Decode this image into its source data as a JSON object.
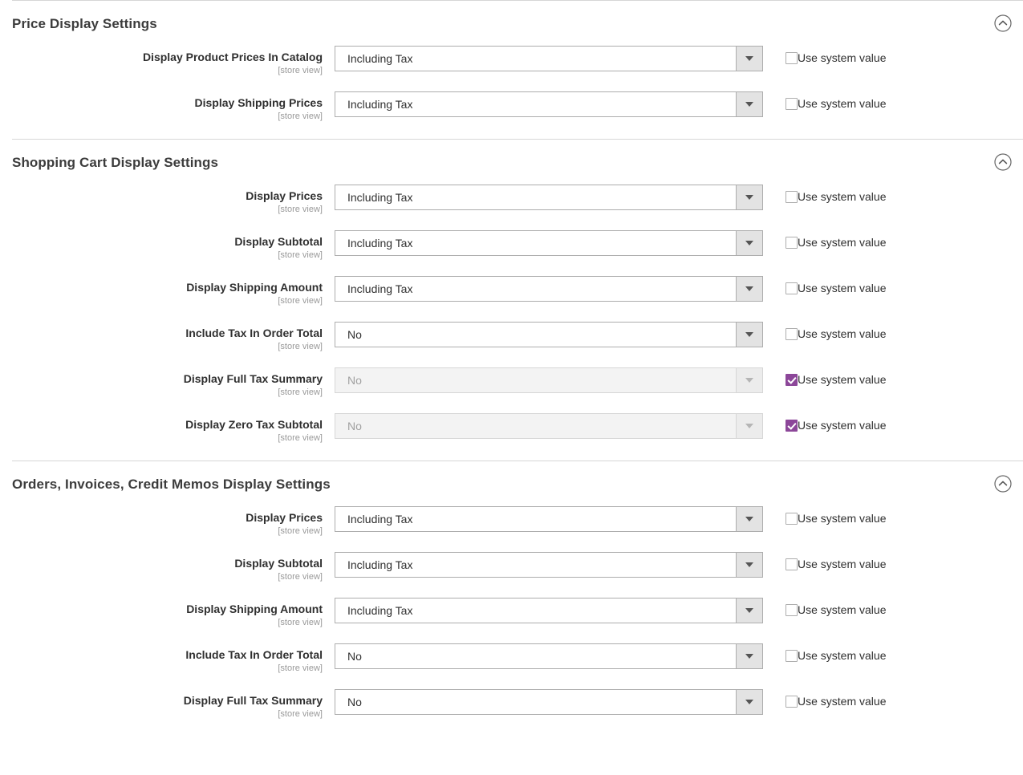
{
  "common": {
    "scope_note": "[store view]",
    "use_system_value_label": "Use system value",
    "collapse_icon": "chevron-up-circle-icon",
    "dropdown_icon": "caret-down-icon",
    "accent_checked_color": "#8c4799",
    "divider_color": "#d6d6d6"
  },
  "sections": [
    {
      "id": "price-display-settings",
      "title": "Price Display Settings",
      "expanded": true,
      "fields": [
        {
          "label": "Display Product Prices In Catalog",
          "scope": "[store view]",
          "value": "Including Tax",
          "disabled": false,
          "use_system_value": false
        },
        {
          "label": "Display Shipping Prices",
          "scope": "[store view]",
          "value": "Including Tax",
          "disabled": false,
          "use_system_value": false
        }
      ]
    },
    {
      "id": "shopping-cart-display-settings",
      "title": "Shopping Cart Display Settings",
      "expanded": true,
      "fields": [
        {
          "label": "Display Prices",
          "scope": "[store view]",
          "value": "Including Tax",
          "disabled": false,
          "use_system_value": false
        },
        {
          "label": "Display Subtotal",
          "scope": "[store view]",
          "value": "Including Tax",
          "disabled": false,
          "use_system_value": false
        },
        {
          "label": "Display Shipping Amount",
          "scope": "[store view]",
          "value": "Including Tax",
          "disabled": false,
          "use_system_value": false
        },
        {
          "label": "Include Tax In Order Total",
          "scope": "[store view]",
          "value": "No",
          "disabled": false,
          "use_system_value": false
        },
        {
          "label": "Display Full Tax Summary",
          "scope": "[store view]",
          "value": "No",
          "disabled": true,
          "use_system_value": true
        },
        {
          "label": "Display Zero Tax Subtotal",
          "scope": "[store view]",
          "value": "No",
          "disabled": true,
          "use_system_value": true
        }
      ]
    },
    {
      "id": "orders-invoices-credit-memos-display-settings",
      "title": "Orders, Invoices, Credit Memos Display Settings",
      "expanded": true,
      "fields": [
        {
          "label": "Display Prices",
          "scope": "[store view]",
          "value": "Including Tax",
          "disabled": false,
          "use_system_value": false
        },
        {
          "label": "Display Subtotal",
          "scope": "[store view]",
          "value": "Including Tax",
          "disabled": false,
          "use_system_value": false
        },
        {
          "label": "Display Shipping Amount",
          "scope": "[store view]",
          "value": "Including Tax",
          "disabled": false,
          "use_system_value": false
        },
        {
          "label": "Include Tax In Order Total",
          "scope": "[store view]",
          "value": "No",
          "disabled": false,
          "use_system_value": false
        },
        {
          "label": "Display Full Tax Summary",
          "scope": "[store view]",
          "value": "No",
          "disabled": false,
          "use_system_value": false
        }
      ]
    }
  ]
}
